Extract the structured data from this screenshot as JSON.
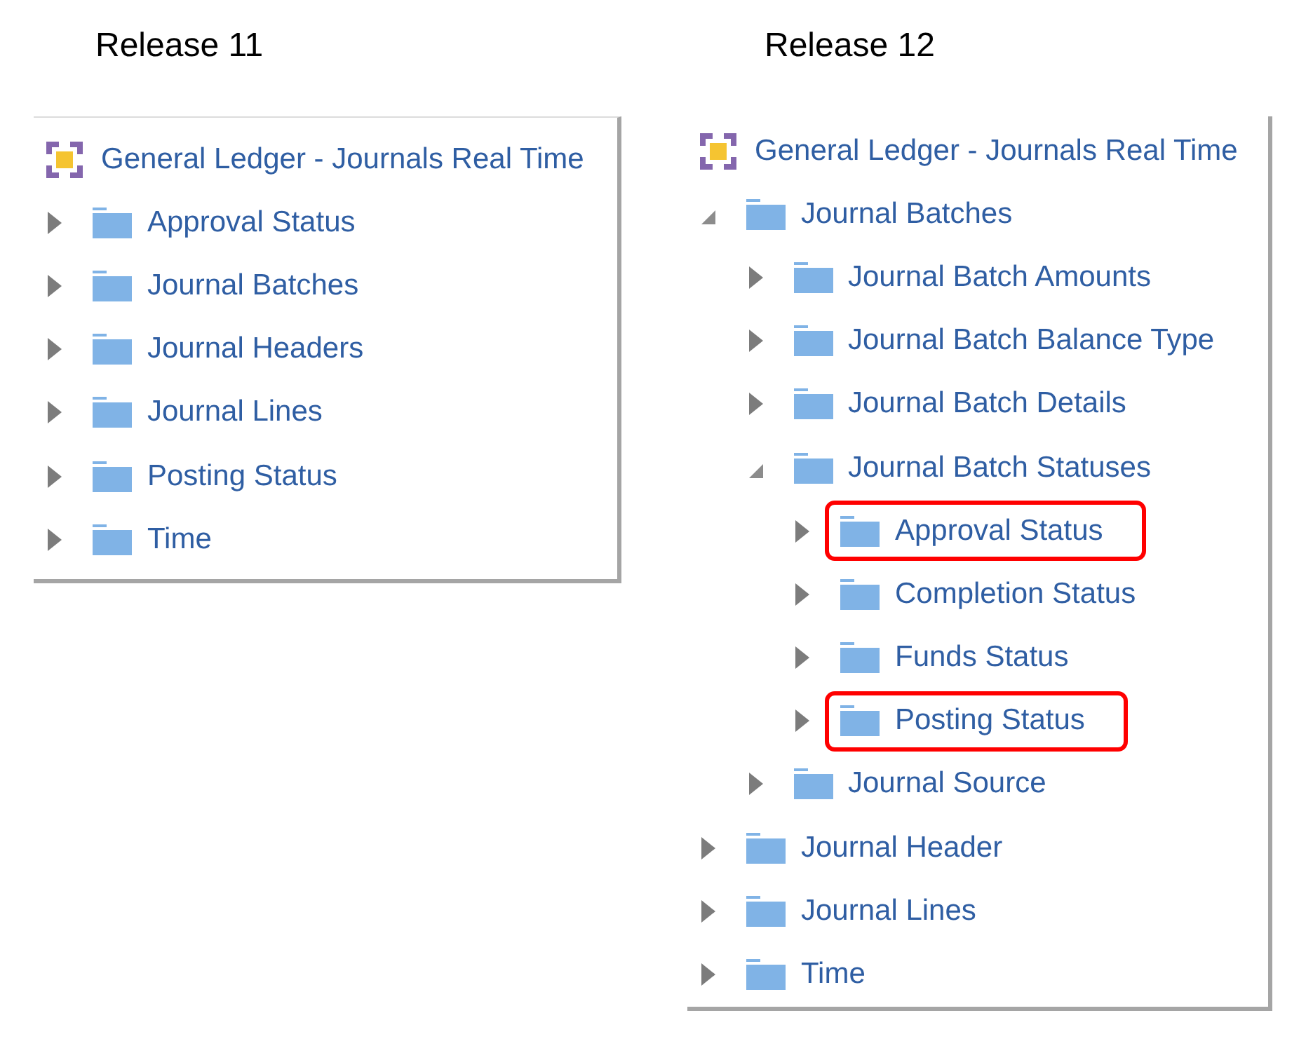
{
  "panels": [
    {
      "heading": "Release 11",
      "root": {
        "label": "General Ledger - Journals Real Time"
      },
      "items": [
        {
          "label": "Approval Status",
          "expanded": false,
          "highlighted": false
        },
        {
          "label": "Journal Batches",
          "expanded": false,
          "highlighted": false
        },
        {
          "label": "Journal Headers",
          "expanded": false,
          "highlighted": false
        },
        {
          "label": "Journal Lines",
          "expanded": false,
          "highlighted": false
        },
        {
          "label": "Posting Status",
          "expanded": false,
          "highlighted": false
        },
        {
          "label": "Time",
          "expanded": false,
          "highlighted": false
        }
      ]
    },
    {
      "heading": "Release 12",
      "root": {
        "label": "General Ledger - Journals Real Time"
      },
      "items": [
        {
          "label": "Journal Batches",
          "expanded": true,
          "highlighted": false,
          "children": [
            {
              "label": "Journal Batch Amounts",
              "expanded": false,
              "highlighted": false
            },
            {
              "label": "Journal Batch Balance Type",
              "expanded": false,
              "highlighted": false
            },
            {
              "label": "Journal Batch Details",
              "expanded": false,
              "highlighted": false
            },
            {
              "label": "Journal Batch Statuses",
              "expanded": true,
              "highlighted": false,
              "children": [
                {
                  "label": "Approval Status",
                  "expanded": false,
                  "highlighted": true
                },
                {
                  "label": "Completion Status",
                  "expanded": false,
                  "highlighted": false
                },
                {
                  "label": "Funds Status",
                  "expanded": false,
                  "highlighted": false
                },
                {
                  "label": "Posting Status",
                  "expanded": false,
                  "highlighted": true
                }
              ]
            },
            {
              "label": "Journal Source",
              "expanded": false,
              "highlighted": false
            }
          ]
        },
        {
          "label": "Journal Header",
          "expanded": false,
          "highlighted": false
        },
        {
          "label": "Journal Lines",
          "expanded": false,
          "highlighted": false
        },
        {
          "label": "Time",
          "expanded": false,
          "highlighted": false
        }
      ]
    }
  ]
}
